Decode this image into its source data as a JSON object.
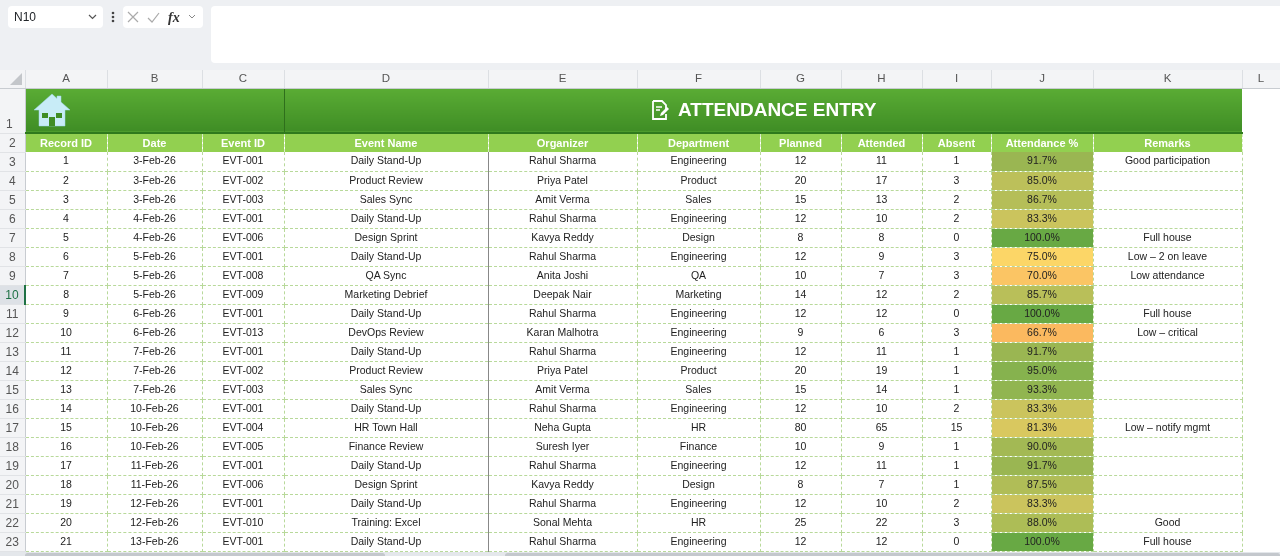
{
  "formula_bar": {
    "name_box": "N10",
    "function_label": "fx"
  },
  "column_letters": [
    "A",
    "B",
    "C",
    "D",
    "E",
    "F",
    "G",
    "H",
    "I",
    "J",
    "K",
    "L"
  ],
  "banner": {
    "row_number": "1",
    "title": "ATTENDANCE ENTRY"
  },
  "table": {
    "header_row_number": "2",
    "columns": [
      "Record ID",
      "Date",
      "Event ID",
      "Event Name",
      "Organizer",
      "Department",
      "Planned",
      "Attended",
      "Absent",
      "Attendance %",
      "Remarks"
    ],
    "rows": [
      {
        "row_number": "3",
        "selected": false,
        "cells": [
          "1",
          "3-Feb-26",
          "EVT-001",
          "Daily Stand-Up",
          "Rahul Sharma",
          "Engineering",
          "12",
          "11",
          "1",
          "91.7%",
          "Good participation"
        ],
        "color": "#9ab652"
      },
      {
        "row_number": "4",
        "selected": false,
        "cells": [
          "2",
          "3-Feb-26",
          "EVT-002",
          "Product Review",
          "Priya Patel",
          "Product",
          "20",
          "17",
          "3",
          "85.0%"
        ],
        "color": "#bcc05a"
      },
      {
        "row_number": "5",
        "selected": false,
        "cells": [
          "3",
          "3-Feb-26",
          "EVT-003",
          "Sales Sync",
          "Amit Verma",
          "Sales",
          "15",
          "13",
          "2",
          "86.7%"
        ],
        "color": "#b5be58"
      },
      {
        "row_number": "6",
        "selected": false,
        "cells": [
          "4",
          "4-Feb-26",
          "EVT-001",
          "Daily Stand-Up",
          "Rahul Sharma",
          "Engineering",
          "12",
          "10",
          "2",
          "83.3%"
        ],
        "color": "#cbc45d"
      },
      {
        "row_number": "7",
        "selected": false,
        "cells": [
          "5",
          "4-Feb-26",
          "EVT-006",
          "Design Sprint",
          "Kavya Reddy",
          "Design",
          "8",
          "8",
          "0",
          "100.0%",
          "Full house"
        ],
        "color": "#68a944"
      },
      {
        "row_number": "8",
        "selected": false,
        "cells": [
          "6",
          "5-Feb-26",
          "EVT-001",
          "Daily Stand-Up",
          "Rahul Sharma",
          "Engineering",
          "12",
          "9",
          "3",
          "75.0%",
          "Low – 2 on leave"
        ],
        "color": "#fcd667"
      },
      {
        "row_number": "9",
        "selected": false,
        "cells": [
          "7",
          "5-Feb-26",
          "EVT-008",
          "QA Sync",
          "Anita Joshi",
          "QA",
          "10",
          "7",
          "3",
          "70.0%",
          "Low attendance"
        ],
        "color": "#fbc564"
      },
      {
        "row_number": "10",
        "selected": true,
        "cells": [
          "8",
          "5-Feb-26",
          "EVT-009",
          "Marketing Debrief",
          "Deepak Nair",
          "Marketing",
          "14",
          "12",
          "2",
          "85.7%"
        ],
        "color": "#b9bf59"
      },
      {
        "row_number": "11",
        "selected": false,
        "cells": [
          "9",
          "6-Feb-26",
          "EVT-001",
          "Daily Stand-Up",
          "Rahul Sharma",
          "Engineering",
          "12",
          "12",
          "0",
          "100.0%",
          "Full house"
        ],
        "color": "#68a944"
      },
      {
        "row_number": "12",
        "selected": false,
        "cells": [
          "10",
          "6-Feb-26",
          "EVT-013",
          "DevOps Review",
          "Karan Malhotra",
          "Engineering",
          "9",
          "6",
          "3",
          "66.7%",
          "Low – critical"
        ],
        "color": "#fbb95f"
      },
      {
        "row_number": "13",
        "selected": false,
        "cells": [
          "11",
          "7-Feb-26",
          "EVT-001",
          "Daily Stand-Up",
          "Rahul Sharma",
          "Engineering",
          "12",
          "11",
          "1",
          "91.7%"
        ],
        "color": "#9ab652"
      },
      {
        "row_number": "14",
        "selected": false,
        "cells": [
          "12",
          "7-Feb-26",
          "EVT-002",
          "Product Review",
          "Priya Patel",
          "Product",
          "20",
          "19",
          "1",
          "95.0%"
        ],
        "color": "#86b24e"
      },
      {
        "row_number": "15",
        "selected": false,
        "cells": [
          "13",
          "7-Feb-26",
          "EVT-003",
          "Sales Sync",
          "Amit Verma",
          "Sales",
          "15",
          "14",
          "1",
          "93.3%"
        ],
        "color": "#91b550"
      },
      {
        "row_number": "16",
        "selected": false,
        "cells": [
          "14",
          "10-Feb-26",
          "EVT-001",
          "Daily Stand-Up",
          "Rahul Sharma",
          "Engineering",
          "12",
          "10",
          "2",
          "83.3%"
        ],
        "color": "#cbc45d"
      },
      {
        "row_number": "17",
        "selected": false,
        "cells": [
          "15",
          "10-Feb-26",
          "EVT-004",
          "HR Town Hall",
          "Neha Gupta",
          "HR",
          "80",
          "65",
          "15",
          "81.3%",
          "Low – notify mgmt"
        ],
        "color": "#d9c85f"
      },
      {
        "row_number": "18",
        "selected": false,
        "cells": [
          "16",
          "10-Feb-26",
          "EVT-005",
          "Finance Review",
          "Suresh Iyer",
          "Finance",
          "10",
          "9",
          "1",
          "90.0%"
        ],
        "color": "#a3b954"
      },
      {
        "row_number": "19",
        "selected": false,
        "cells": [
          "17",
          "11-Feb-26",
          "EVT-001",
          "Daily Stand-Up",
          "Rahul Sharma",
          "Engineering",
          "12",
          "11",
          "1",
          "91.7%"
        ],
        "color": "#9ab652"
      },
      {
        "row_number": "20",
        "selected": false,
        "cells": [
          "18",
          "11-Feb-26",
          "EVT-006",
          "Design Sprint",
          "Kavya Reddy",
          "Design",
          "8",
          "7",
          "1",
          "87.5%"
        ],
        "color": "#b0bd57"
      },
      {
        "row_number": "21",
        "selected": false,
        "cells": [
          "19",
          "12-Feb-26",
          "EVT-001",
          "Daily Stand-Up",
          "Rahul Sharma",
          "Engineering",
          "12",
          "10",
          "2",
          "83.3%"
        ],
        "color": "#cbc45d"
      },
      {
        "row_number": "22",
        "selected": false,
        "cells": [
          "20",
          "12-Feb-26",
          "EVT-010",
          "Training: Excel",
          "Sonal Mehta",
          "HR",
          "25",
          "22",
          "3",
          "88.0%",
          "Good"
        ],
        "color": "#adbd56"
      },
      {
        "row_number": "23",
        "selected": false,
        "cells": [
          "21",
          "13-Feb-26",
          "EVT-001",
          "Daily Stand-Up",
          "Rahul Sharma",
          "Engineering",
          "12",
          "12",
          "0",
          "100.0%",
          "Full house"
        ],
        "color": "#68a944"
      }
    ]
  }
}
